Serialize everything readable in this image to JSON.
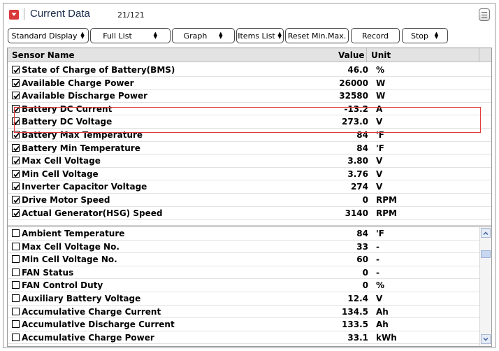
{
  "header": {
    "title": "Current Data",
    "count": "21/121"
  },
  "toolbar": {
    "standard_display": "Standard Display",
    "full_list": "Full List",
    "graph": "Graph",
    "items_list": "Items List",
    "reset_min_max": "Reset Min.Max.",
    "record": "Record",
    "stop": "Stop"
  },
  "table": {
    "columns": {
      "sensor_name": "Sensor Name",
      "value": "Value",
      "unit": "Unit"
    },
    "selected_rows": [
      {
        "name": "State of Charge of Battery(BMS)",
        "value": "46.0",
        "unit": "%",
        "checked": true
      },
      {
        "name": "Available Charge Power",
        "value": "26000",
        "unit": "W",
        "checked": true
      },
      {
        "name": "Available Discharge Power",
        "value": "32580",
        "unit": "W",
        "checked": true
      },
      {
        "name": "Battery DC Current",
        "value": "-13.2",
        "unit": "A",
        "checked": true
      },
      {
        "name": "Battery DC Voltage",
        "value": "273.0",
        "unit": "V",
        "checked": true
      },
      {
        "name": "Battery Max Temperature",
        "value": "84",
        "unit": "'F",
        "checked": true
      },
      {
        "name": "Battery Min Temperature",
        "value": "84",
        "unit": "'F",
        "checked": true
      },
      {
        "name": "Max Cell Voltage",
        "value": "3.80",
        "unit": "V",
        "checked": true
      },
      {
        "name": "Min Cell Voltage",
        "value": "3.76",
        "unit": "V",
        "checked": true
      },
      {
        "name": "Inverter Capacitor Voltage",
        "value": "274",
        "unit": "V",
        "checked": true
      },
      {
        "name": "Drive Motor Speed",
        "value": "0",
        "unit": "RPM",
        "checked": true
      },
      {
        "name": "Actual Generator(HSG) Speed",
        "value": "3140",
        "unit": "RPM",
        "checked": true
      }
    ],
    "unselected_rows": [
      {
        "name": "Ambient Temperature",
        "value": "84",
        "unit": "'F",
        "checked": false
      },
      {
        "name": "Max Cell Voltage No.",
        "value": "33",
        "unit": "-",
        "checked": false
      },
      {
        "name": "Min Cell Voltage No.",
        "value": "60",
        "unit": "-",
        "checked": false
      },
      {
        "name": "FAN Status",
        "value": "0",
        "unit": "-",
        "checked": false
      },
      {
        "name": "FAN Control Duty",
        "value": "0",
        "unit": "%",
        "checked": false
      },
      {
        "name": "Auxiliary Battery Voltage",
        "value": "12.4",
        "unit": "V",
        "checked": false
      },
      {
        "name": "Accumulative Charge Current",
        "value": "134.5",
        "unit": "Ah",
        "checked": false
      },
      {
        "name": "Accumulative Discharge Current",
        "value": "133.5",
        "unit": "Ah",
        "checked": false
      },
      {
        "name": "Accumulative Charge Power",
        "value": "33.1",
        "unit": "kWh",
        "checked": false
      }
    ]
  },
  "colors": {
    "menu_button": "#d9383a",
    "highlight_border": "#e23a3a",
    "header_row_bg": "#e3e3e3"
  },
  "icons": {
    "menu": "chevron-down-icon",
    "list_view": "list-icon",
    "checkbox_checked": "checkmark-icon"
  }
}
